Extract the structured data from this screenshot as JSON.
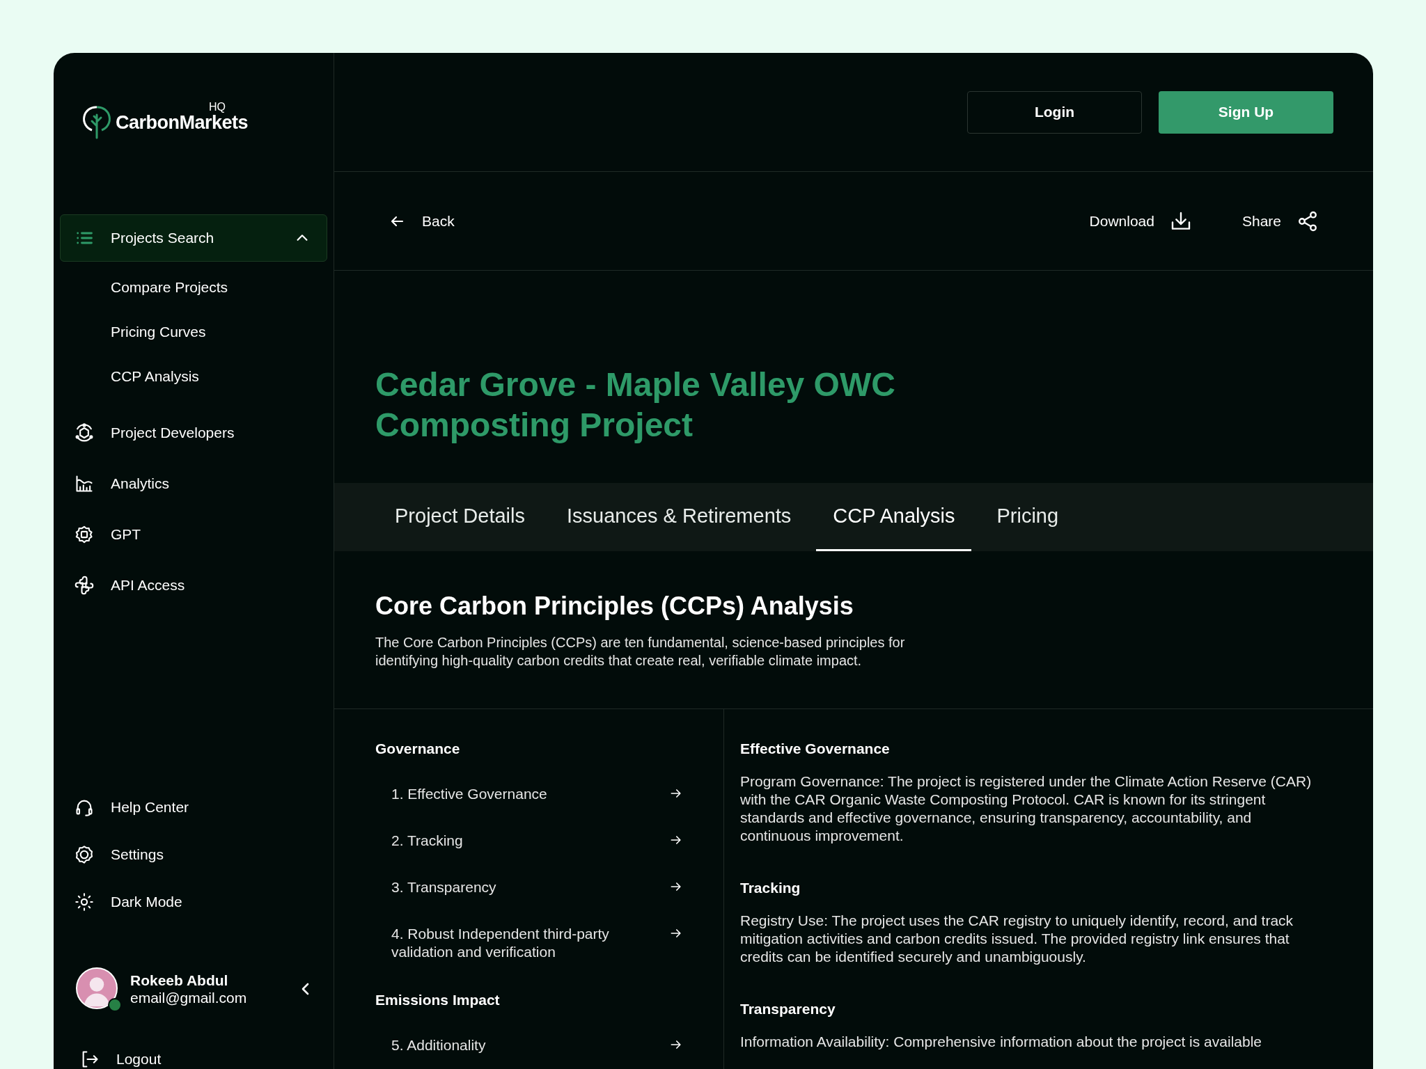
{
  "logo": {
    "name": "CarbonMarkets",
    "superscript": "HQ"
  },
  "sidebar": {
    "items": [
      {
        "label": "Projects Search",
        "kind": "list",
        "selected": true,
        "expanded": true,
        "children": [
          {
            "label": "Compare Projects",
            "selected": false
          },
          {
            "label": "Pricing Curves",
            "selected": false
          },
          {
            "label": "CCP Analysis",
            "selected": false
          }
        ]
      },
      {
        "label": "Project Developers",
        "kind": "hexagon",
        "selected": false
      },
      {
        "label": "Analytics",
        "kind": "chart",
        "selected": false
      },
      {
        "label": "GPT",
        "kind": "chip",
        "selected": false
      },
      {
        "label": "API Access",
        "kind": "knot",
        "selected": false
      }
    ],
    "bottom_items": [
      {
        "label": "Help Center",
        "kind": "headset",
        "selected": false
      },
      {
        "label": "Settings",
        "kind": "gear",
        "selected": false
      },
      {
        "label": "Dark Mode",
        "kind": "sun",
        "selected": false
      }
    ],
    "user": {
      "name": "Rokeeb Abdul",
      "email": "email@gmail.com",
      "online": true
    },
    "logout": "Logout"
  },
  "header": {
    "buttons": [
      {
        "label": "Login",
        "kind": "outline"
      },
      {
        "label": "Sign Up",
        "kind": "primary"
      }
    ]
  },
  "toolbar": {
    "back": "Back",
    "actions": [
      {
        "label": "Download",
        "kind": "download"
      },
      {
        "label": "Share",
        "kind": "share"
      }
    ]
  },
  "project_title": "Cedar Grove - Maple Valley OWC Composting Project",
  "tabs": [
    {
      "label": "Project Details",
      "selected": false
    },
    {
      "label": "Issuances & Retirements",
      "selected": false
    },
    {
      "label": "CCP Analysis",
      "selected": true
    },
    {
      "label": "Pricing",
      "selected": false
    }
  ],
  "section": {
    "title": "Core Carbon Principles (CCPs) Analysis",
    "description": "The Core Carbon Principles (CCPs) are ten fundamental, science-based principles for identifying high-quality carbon credits that create real, verifiable climate impact."
  },
  "principles": [
    {
      "group": "Governance",
      "items": [
        "1. Effective Governance",
        "2. Tracking",
        "3. Transparency",
        "4. Robust Independent third-party validation and verification"
      ]
    },
    {
      "group": "Emissions Impact",
      "items": [
        "5. Additionality"
      ]
    }
  ],
  "details": [
    {
      "title": "Effective Governance",
      "text": "Program Governance: The project is registered under the Climate Action Reserve (CAR) with the CAR Organic Waste Composting Protocol. CAR is known for its stringent standards and effective governance, ensuring transparency, accountability, and continuous improvement."
    },
    {
      "title": "Tracking",
      "text": "Registry Use: The project uses the CAR registry to uniquely identify, record, and track mitigation activities and carbon credits issued. The provided registry link ensures that credits can be identified securely and unambiguously."
    },
    {
      "title": "Transparency",
      "text": "Information Availability: Comprehensive information about the project is available"
    }
  ]
}
